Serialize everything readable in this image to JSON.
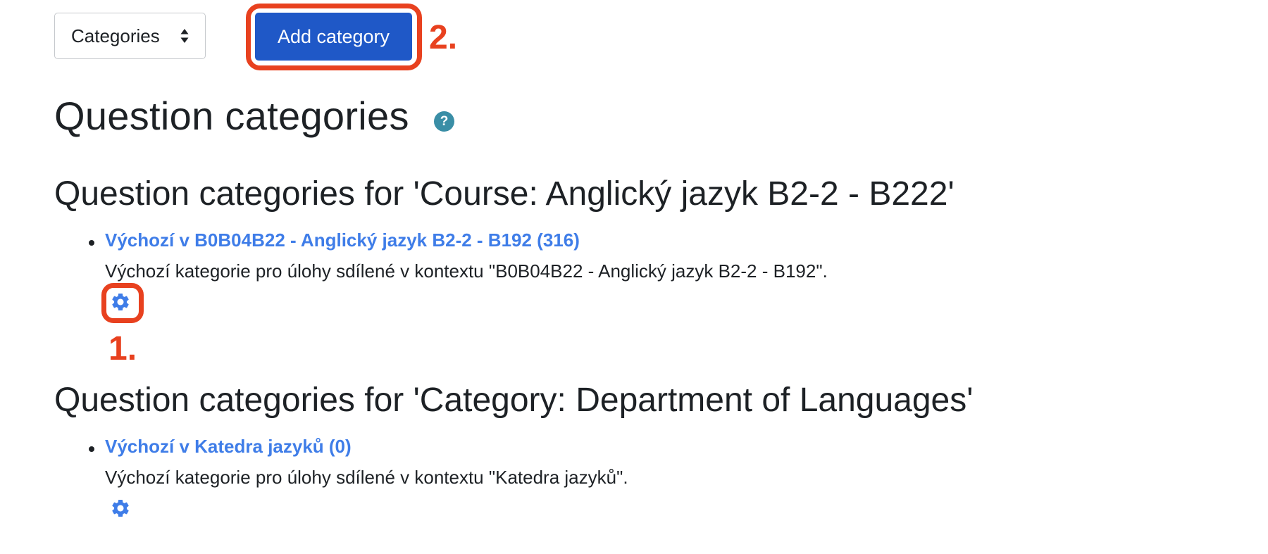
{
  "toolbar": {
    "select_value": "Categories",
    "add_button_label": "Add category"
  },
  "annotations": {
    "step1": "1.",
    "step2": "2."
  },
  "page": {
    "title": "Question categories",
    "help_icon_glyph": "?"
  },
  "contexts": [
    {
      "heading": "Question categories for 'Course: Anglický jazyk B2-2 - B222'",
      "items": [
        {
          "link": "Výchozí v B0B04B22 - Anglický jazyk B2-2 - B192 (316)",
          "description": "Výchozí kategorie pro úlohy sdílené v kontextu \"B0B04B22 - Anglický jazyk B2-2 - B192\".",
          "icon": "gear-icon"
        }
      ]
    },
    {
      "heading": "Question categories for 'Category: Department of Languages'",
      "items": [
        {
          "link": "Výchozí v Katedra jazyků (0)",
          "description": "Výchozí kategorie pro úlohy sdílené v kontextu \"Katedra jazyků\".",
          "icon": "gear-icon"
        }
      ]
    }
  ],
  "colors": {
    "accent_blue": "#1f58c7",
    "link_blue": "#3f7de8",
    "annotation_red": "#e8411f",
    "help_teal": "#3a8ea6"
  }
}
